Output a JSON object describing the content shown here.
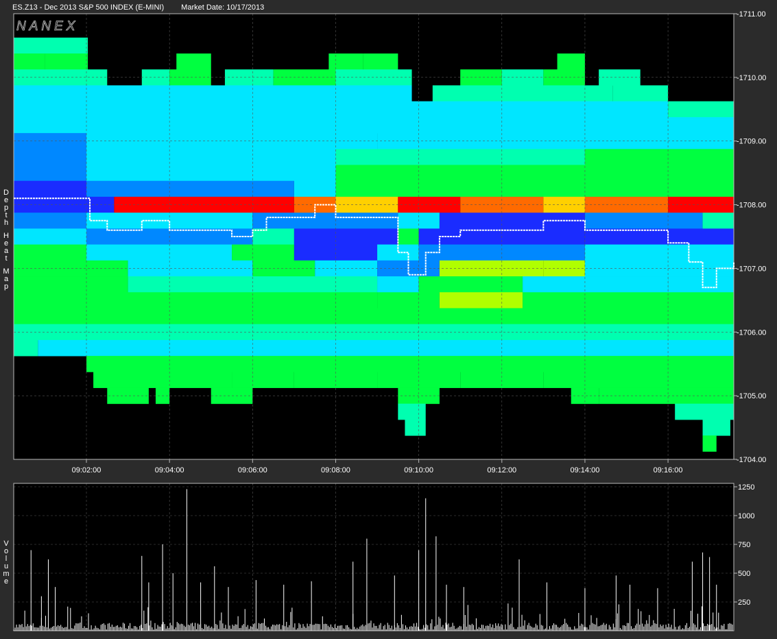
{
  "header": {
    "symbol": "ES.Z13 - Dec 2013 S&P 500 INDEX (E-MINI)",
    "market_date": "Market Date: 10/17/2013"
  },
  "logo_text": "NANEX",
  "side_labels": {
    "heatmap": "Depth Heat Map",
    "volume": "Volume"
  },
  "colors": {
    "background": "#2b2b2b",
    "plot_background": "#000000",
    "grid": "#555555",
    "price_trace": "#ffffff"
  },
  "chart_data": [
    {
      "type": "heatmap",
      "title": "Depth Heat Map",
      "x_tick_labels": [
        "09:02:00",
        "09:04:00",
        "09:06:00",
        "09:08:00",
        "09:10:00",
        "09:12:00",
        "09:14:00",
        "09:16:00"
      ],
      "y_tick_labels": [
        "-1711.00",
        "-1710.00",
        "-1709.00",
        "-1708.00",
        "-1707.00",
        "-1706.00",
        "-1705.00",
        "-1704.00"
      ],
      "xlim": [
        "09:00:15",
        "09:17:35"
      ],
      "ylim": [
        1704.0,
        1711.0
      ],
      "price_levels": [
        1710.5,
        1710.25,
        1710.0,
        1709.75,
        1709.5,
        1709.25,
        1709.0,
        1708.75,
        1708.5,
        1708.25,
        1708.0,
        1707.75,
        1707.5,
        1707.25,
        1707.0,
        1706.75,
        1706.5,
        1706.25,
        1706.0,
        1705.75,
        1705.5,
        1705.25,
        1705.0,
        1704.75,
        1704.5,
        1704.25
      ],
      "color_scale": [
        "#1a2cff",
        "#0088ff",
        "#00e6ff",
        "#00ffb0",
        "#00ff40",
        "#b0ff00",
        "#ffd000",
        "#ff6a00",
        "#ff0000"
      ],
      "segments": [
        {
          "price": 1710.5,
          "cells": [
            [
              "09:00:15",
              "09:02:02",
              3
            ]
          ]
        },
        {
          "price": 1710.25,
          "cells": [
            [
              "09:00:15",
              "09:01:00",
              4
            ],
            [
              "09:01:00",
              "09:02:02",
              4
            ],
            [
              "09:04:10",
              "09:05:00",
              4
            ],
            [
              "09:07:50",
              "09:08:40",
              4
            ],
            [
              "09:08:40",
              "09:09:30",
              4
            ],
            [
              "09:13:20",
              "09:14:00",
              4
            ]
          ]
        },
        {
          "price": 1710.0,
          "cells": [
            [
              "09:00:15",
              "09:02:30",
              3
            ],
            [
              "09:03:20",
              "09:04:00",
              3
            ],
            [
              "09:04:00",
              "09:05:00",
              4
            ],
            [
              "09:05:20",
              "09:06:30",
              3
            ],
            [
              "09:06:30",
              "09:08:00",
              4
            ],
            [
              "09:08:00",
              "09:09:50",
              3
            ],
            [
              "09:11:00",
              "09:12:00",
              4
            ],
            [
              "09:12:00",
              "09:13:00",
              3
            ],
            [
              "09:13:00",
              "09:14:00",
              4
            ],
            [
              "09:14:20",
              "09:15:20",
              3
            ]
          ]
        },
        {
          "price": 1709.75,
          "cells": [
            [
              "09:00:15",
              "09:09:50",
              2
            ],
            [
              "09:10:20",
              "09:14:40",
              3
            ],
            [
              "09:14:40",
              "09:16:00",
              3
            ]
          ]
        },
        {
          "price": 1709.5,
          "cells": [
            [
              "09:00:15",
              "09:16:00",
              2
            ],
            [
              "09:16:00",
              "09:17:35",
              3
            ]
          ]
        },
        {
          "price": 1709.25,
          "cells": [
            [
              "09:00:15",
              "09:17:35",
              2
            ]
          ]
        },
        {
          "price": 1709.0,
          "cells": [
            [
              "09:00:15",
              "09:02:00",
              1
            ],
            [
              "09:02:00",
              "09:09:00",
              2
            ],
            [
              "09:09:00",
              "09:17:35",
              2
            ]
          ]
        },
        {
          "price": 1708.75,
          "cells": [
            [
              "09:00:15",
              "09:02:00",
              1
            ],
            [
              "09:02:00",
              "09:08:00",
              2
            ],
            [
              "09:08:00",
              "09:14:00",
              3
            ],
            [
              "09:14:00",
              "09:17:35",
              4
            ]
          ]
        },
        {
          "price": 1708.5,
          "cells": [
            [
              "09:00:15",
              "09:02:00",
              1
            ],
            [
              "09:02:00",
              "09:08:00",
              2
            ],
            [
              "09:08:00",
              "09:17:35",
              4
            ]
          ]
        },
        {
          "price": 1708.25,
          "cells": [
            [
              "09:00:15",
              "09:02:00",
              0
            ],
            [
              "09:02:00",
              "09:07:00",
              1
            ],
            [
              "09:07:00",
              "09:08:00",
              2
            ],
            [
              "09:08:00",
              "09:17:35",
              4
            ]
          ]
        },
        {
          "price": 1708.0,
          "cells": [
            [
              "09:00:15",
              "09:02:40",
              0
            ],
            [
              "09:02:40",
              "09:07:00",
              8
            ],
            [
              "09:07:00",
              "09:08:00",
              7
            ],
            [
              "09:08:00",
              "09:09:30",
              6
            ],
            [
              "09:09:30",
              "09:11:00",
              8
            ],
            [
              "09:11:00",
              "09:13:00",
              7
            ],
            [
              "09:13:00",
              "09:14:00",
              6
            ],
            [
              "09:14:00",
              "09:16:00",
              7
            ],
            [
              "09:16:00",
              "09:17:35",
              8
            ]
          ]
        },
        {
          "price": 1707.75,
          "cells": [
            [
              "09:00:15",
              "09:02:00",
              1
            ],
            [
              "09:02:00",
              "09:06:00",
              2
            ],
            [
              "09:06:00",
              "09:09:30",
              1
            ],
            [
              "09:09:30",
              "09:10:30",
              2
            ],
            [
              "09:10:30",
              "09:14:00",
              0
            ],
            [
              "09:14:00",
              "09:16:50",
              1
            ],
            [
              "09:16:50",
              "09:17:35",
              3
            ]
          ]
        },
        {
          "price": 1707.5,
          "cells": [
            [
              "09:00:15",
              "09:02:00",
              2
            ],
            [
              "09:02:00",
              "09:06:00",
              1
            ],
            [
              "09:06:00",
              "09:07:00",
              3
            ],
            [
              "09:07:00",
              "09:09:30",
              0
            ],
            [
              "09:09:30",
              "09:10:00",
              4
            ],
            [
              "09:10:00",
              "09:14:00",
              0
            ],
            [
              "09:14:00",
              "09:17:35",
              0
            ]
          ]
        },
        {
          "price": 1707.25,
          "cells": [
            [
              "09:00:15",
              "09:02:00",
              4
            ],
            [
              "09:02:00",
              "09:05:30",
              2
            ],
            [
              "09:05:30",
              "09:07:00",
              4
            ],
            [
              "09:07:00",
              "09:09:00",
              0
            ],
            [
              "09:09:00",
              "09:10:00",
              2
            ],
            [
              "09:10:00",
              "09:14:00",
              1
            ],
            [
              "09:14:00",
              "09:17:35",
              2
            ]
          ]
        },
        {
          "price": 1707.0,
          "cells": [
            [
              "09:00:15",
              "09:03:00",
              4
            ],
            [
              "09:03:00",
              "09:06:00",
              2
            ],
            [
              "09:06:00",
              "09:07:30",
              4
            ],
            [
              "09:07:30",
              "09:09:00",
              2
            ],
            [
              "09:09:00",
              "09:10:30",
              1
            ],
            [
              "09:10:30",
              "09:13:00",
              5
            ],
            [
              "09:13:00",
              "09:14:00",
              5
            ],
            [
              "09:14:00",
              "09:17:35",
              2
            ]
          ]
        },
        {
          "price": 1706.75,
          "cells": [
            [
              "09:00:15",
              "09:03:00",
              4
            ],
            [
              "09:03:00",
              "09:09:00",
              3
            ],
            [
              "09:09:00",
              "09:10:00",
              2
            ],
            [
              "09:10:00",
              "09:12:30",
              4
            ],
            [
              "09:12:30",
              "09:16:00",
              2
            ],
            [
              "09:16:00",
              "09:17:35",
              2
            ]
          ]
        },
        {
          "price": 1706.5,
          "cells": [
            [
              "09:00:15",
              "09:09:00",
              4
            ],
            [
              "09:09:00",
              "09:10:30",
              4
            ],
            [
              "09:10:30",
              "09:12:30",
              5
            ],
            [
              "09:12:30",
              "09:17:35",
              4
            ]
          ]
        },
        {
          "price": 1706.25,
          "cells": [
            [
              "09:00:15",
              "09:17:35",
              4
            ]
          ]
        },
        {
          "price": 1706.0,
          "cells": [
            [
              "09:00:15",
              "09:17:35",
              3
            ]
          ]
        },
        {
          "price": 1705.75,
          "cells": [
            [
              "09:00:15",
              "09:00:50",
              3
            ],
            [
              "09:00:50",
              "09:17:35",
              2
            ]
          ]
        },
        {
          "price": 1705.5,
          "cells": [
            [
              "09:02:00",
              "09:17:35",
              4
            ]
          ]
        },
        {
          "price": 1705.25,
          "cells": [
            [
              "09:02:10",
              "09:05:30",
              4
            ],
            [
              "09:05:30",
              "09:07:00",
              4
            ],
            [
              "09:07:00",
              "09:09:00",
              4
            ],
            [
              "09:09:00",
              "09:11:00",
              4
            ],
            [
              "09:11:00",
              "09:13:00",
              4
            ],
            [
              "09:13:00",
              "09:17:35",
              4
            ]
          ]
        },
        {
          "price": 1705.0,
          "cells": [
            [
              "09:02:30",
              "09:03:30",
              4
            ],
            [
              "09:03:40",
              "09:04:00",
              4
            ],
            [
              "09:05:00",
              "09:06:00",
              4
            ],
            [
              "09:09:30",
              "09:10:30",
              4
            ],
            [
              "09:13:40",
              "09:14:20",
              4
            ],
            [
              "09:14:20",
              "09:17:35",
              4
            ]
          ]
        },
        {
          "price": 1704.75,
          "cells": [
            [
              "09:09:30",
              "09:10:10",
              3
            ],
            [
              "09:16:10",
              "09:17:35",
              3
            ]
          ]
        },
        {
          "price": 1704.5,
          "cells": [
            [
              "09:09:40",
              "09:10:10",
              3
            ],
            [
              "09:16:50",
              "09:17:30",
              3
            ]
          ]
        },
        {
          "price": 1704.25,
          "cells": [
            [
              "09:16:50",
              "09:17:10",
              4
            ]
          ]
        }
      ],
      "price_trace": [
        [
          "09:00:15",
          1708.1
        ],
        [
          "09:01:00",
          1708.1
        ],
        [
          "09:02:00",
          1708.1
        ],
        [
          "09:02:05",
          1707.75
        ],
        [
          "09:02:30",
          1707.6
        ],
        [
          "09:03:00",
          1707.6
        ],
        [
          "09:03:20",
          1707.75
        ],
        [
          "09:04:00",
          1707.6
        ],
        [
          "09:05:00",
          1707.6
        ],
        [
          "09:05:30",
          1707.5
        ],
        [
          "09:06:00",
          1707.6
        ],
        [
          "09:06:20",
          1707.8
        ],
        [
          "09:07:00",
          1707.8
        ],
        [
          "09:07:30",
          1708.0
        ],
        [
          "09:08:00",
          1707.8
        ],
        [
          "09:09:00",
          1707.8
        ],
        [
          "09:09:30",
          1707.25
        ],
        [
          "09:09:45",
          1706.9
        ],
        [
          "09:10:10",
          1707.25
        ],
        [
          "09:10:30",
          1707.5
        ],
        [
          "09:11:00",
          1707.6
        ],
        [
          "09:12:00",
          1707.6
        ],
        [
          "09:13:00",
          1707.75
        ],
        [
          "09:14:00",
          1707.6
        ],
        [
          "09:15:00",
          1707.6
        ],
        [
          "09:16:00",
          1707.4
        ],
        [
          "09:16:30",
          1707.1
        ],
        [
          "09:16:50",
          1706.7
        ],
        [
          "09:17:10",
          1707.0
        ],
        [
          "09:17:35",
          1707.1
        ]
      ]
    },
    {
      "type": "bar",
      "title": "Volume",
      "x_tick_labels": [
        "09:02:00",
        "09:04:00",
        "09:06:00",
        "09:08:00",
        "09:10:00",
        "09:12:00",
        "09:14:00",
        "09:16:00"
      ],
      "y_tick_labels": [
        "1250",
        "1000",
        "750",
        "500",
        "250"
      ],
      "ylim": [
        0,
        1250
      ],
      "xlim": [
        "09:00:15",
        "09:17:35"
      ],
      "spikes": [
        [
          "09:00:40",
          700
        ],
        [
          "09:00:55",
          300
        ],
        [
          "09:01:05",
          620
        ],
        [
          "09:01:15",
          380
        ],
        [
          "09:03:20",
          650
        ],
        [
          "09:03:30",
          420
        ],
        [
          "09:03:50",
          750
        ],
        [
          "09:04:05",
          500
        ],
        [
          "09:04:25",
          1230
        ],
        [
          "09:04:45",
          420
        ],
        [
          "09:05:05",
          560
        ],
        [
          "09:05:25",
          380
        ],
        [
          "09:06:05",
          440
        ],
        [
          "09:06:45",
          400
        ],
        [
          "09:07:25",
          430
        ],
        [
          "09:08:25",
          600
        ],
        [
          "09:08:45",
          800
        ],
        [
          "09:09:25",
          480
        ],
        [
          "09:10:00",
          700
        ],
        [
          "09:10:10",
          1150
        ],
        [
          "09:10:25",
          820
        ],
        [
          "09:10:40",
          400
        ],
        [
          "09:11:05",
          380
        ],
        [
          "09:12:25",
          620
        ],
        [
          "09:13:05",
          420
        ],
        [
          "09:14:00",
          370
        ],
        [
          "09:14:45",
          480
        ],
        [
          "09:15:05",
          400
        ],
        [
          "09:15:45",
          370
        ],
        [
          "09:16:35",
          600
        ],
        [
          "09:16:50",
          680
        ],
        [
          "09:17:00",
          640
        ],
        [
          "09:17:10",
          400
        ]
      ]
    }
  ]
}
